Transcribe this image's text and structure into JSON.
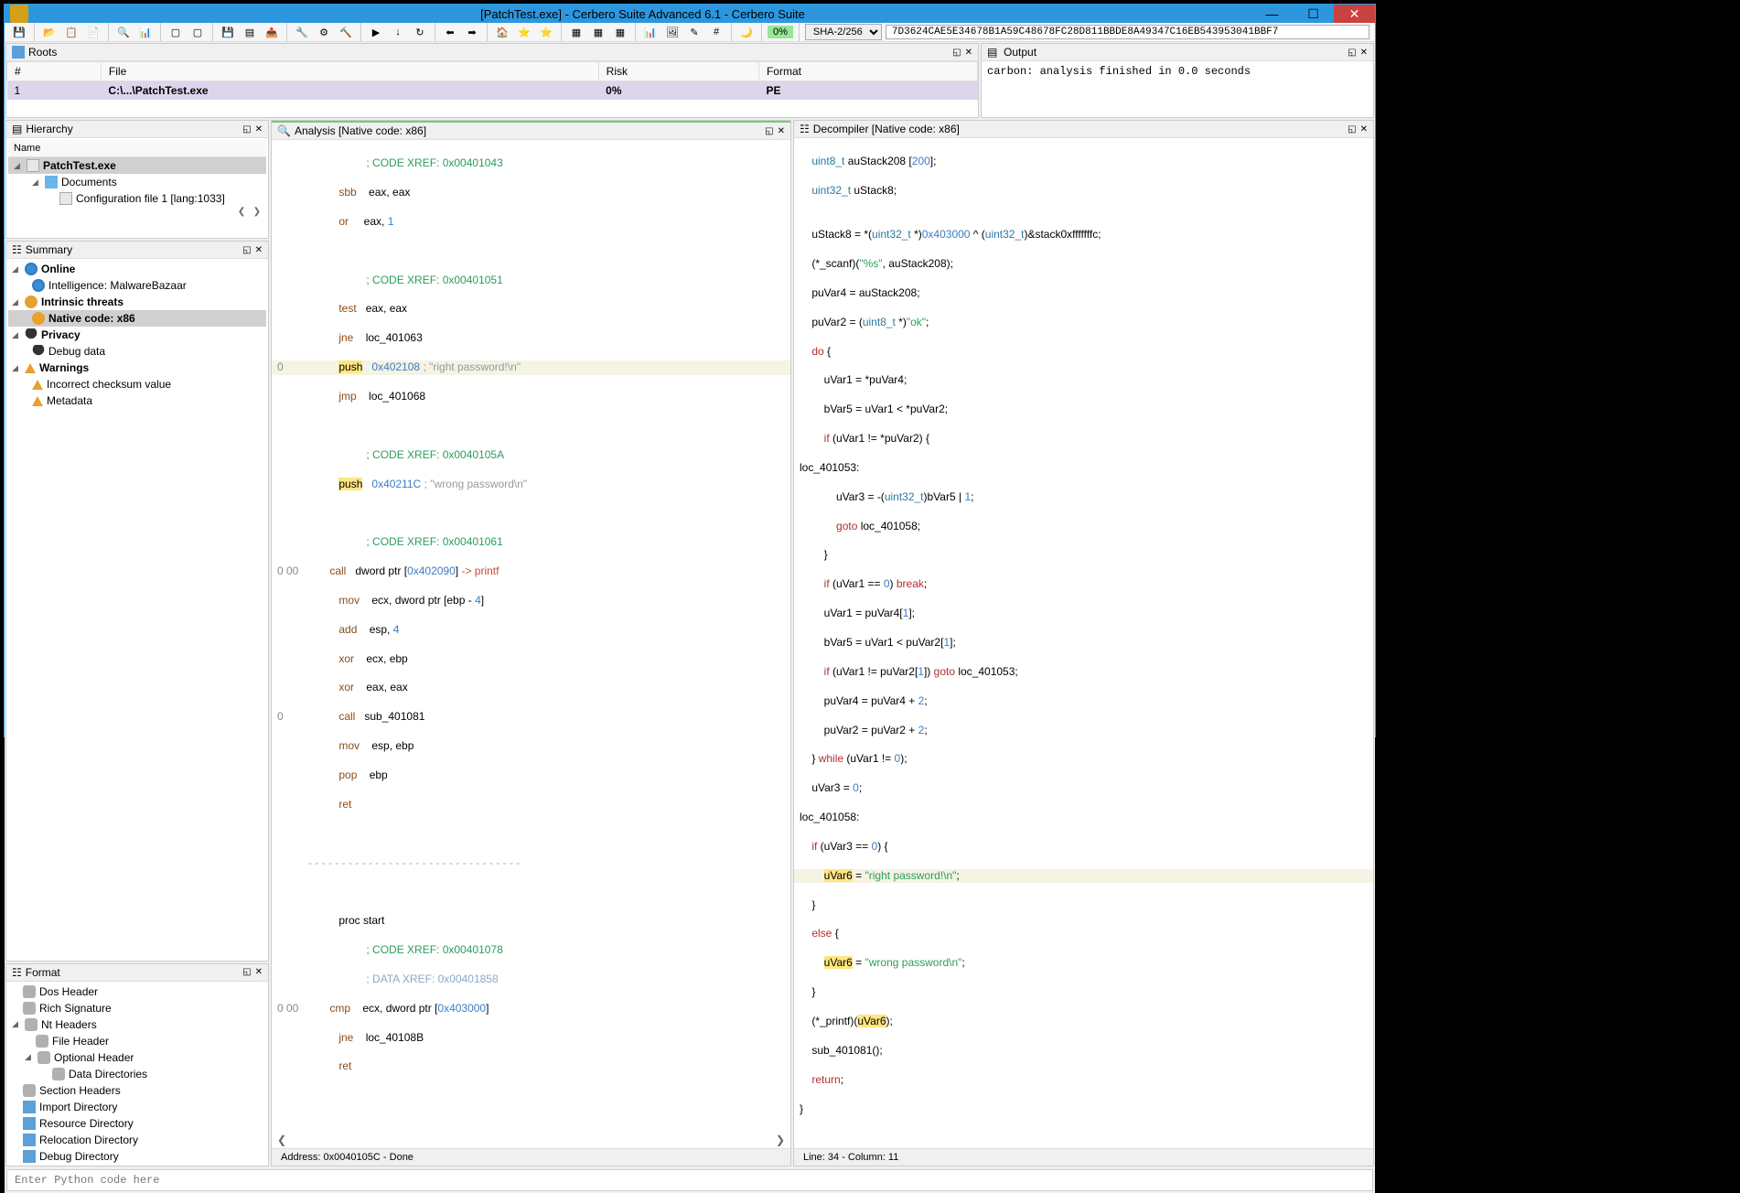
{
  "window": {
    "title": "[PatchTest.exe] - Cerbero Suite Advanced 6.1 - Cerbero Suite"
  },
  "toolbar": {
    "percent": "0%",
    "hash_algo": "SHA-2/256",
    "hash": "7D3624CAE5E34678B1A59C48678FC28D811BBDE8A49347C16EB543953041BBF7"
  },
  "panels": {
    "roots": "Roots",
    "output": "Output",
    "hierarchy": "Hierarchy",
    "summary": "Summary",
    "format": "Format",
    "analysis": "Analysis [Native code: x86]",
    "decompiler": "Decompiler [Native code: x86]"
  },
  "roots": {
    "cols": {
      "num": "#",
      "file": "File",
      "risk": "Risk",
      "format": "Format"
    },
    "row": {
      "num": "1",
      "file": "C:\\...\\PatchTest.exe",
      "risk": "0%",
      "format": "PE"
    }
  },
  "output": {
    "text": "carbon: analysis finished in 0.0 seconds"
  },
  "hierarchy": {
    "col": "Name",
    "items": {
      "root": "PatchTest.exe",
      "docs": "Documents",
      "cfg": "Configuration file 1 [lang:1033]"
    }
  },
  "summary": {
    "online": "Online",
    "intel": "Intelligence: MalwareBazaar",
    "intrinsic": "Intrinsic threats",
    "native": "Native code: x86",
    "privacy": "Privacy",
    "debug": "Debug data",
    "warnings": "Warnings",
    "checksum": "Incorrect checksum value",
    "metadata": "Metadata"
  },
  "format": {
    "dos": "Dos Header",
    "rich": "Rich Signature",
    "nt": "Nt Headers",
    "fileh": "File Header",
    "opth": "Optional Header",
    "datadir": "Data Directories",
    "sect": "Section Headers",
    "import": "Import Directory",
    "resource": "Resource Directory",
    "reloc": "Relocation Directory",
    "debugdir": "Debug Directory"
  },
  "analysis": {
    "status": "Address: 0x0040105C - Done"
  },
  "decompiler": {
    "status": "Line: 34 - Column: 11"
  },
  "footer": {
    "placeholder": "Enter Python code here"
  }
}
